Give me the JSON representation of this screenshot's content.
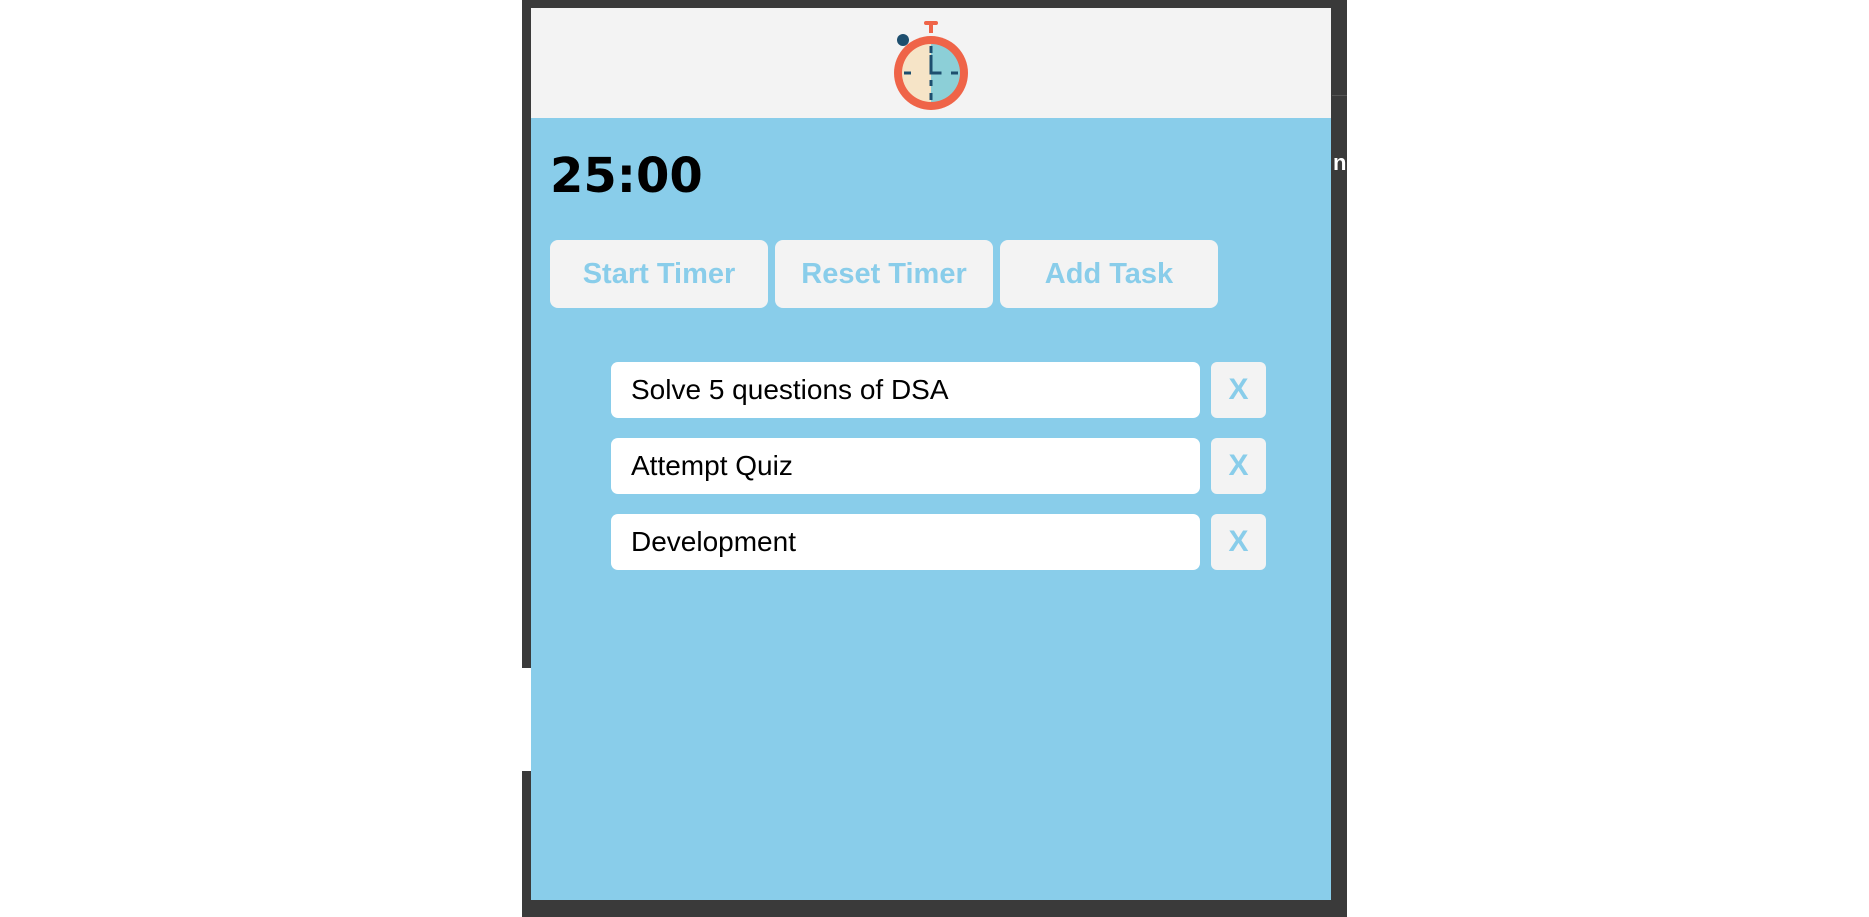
{
  "colors": {
    "accent": "#89cdea",
    "button_bg": "#f3f3f3",
    "header_bg": "#f3f3f3",
    "frame": "#3a3a3a",
    "logo_ring": "#ef6448",
    "logo_face": "#f6e4c7",
    "logo_face_right": "#8ccfd7",
    "logo_ticks": "#1d4e6e"
  },
  "header": {
    "logo_icon": "stopwatch-icon"
  },
  "timer": {
    "display": "25:00"
  },
  "controls": {
    "start_label": "Start Timer",
    "reset_label": "Reset Timer",
    "add_label": "Add Task"
  },
  "tasks": [
    {
      "text": "Solve 5 questions of DSA",
      "delete_label": "X"
    },
    {
      "text": "Attempt Quiz",
      "delete_label": "X"
    },
    {
      "text": "Development",
      "delete_label": "X"
    }
  ],
  "background": {
    "partial_glyph": "n"
  }
}
